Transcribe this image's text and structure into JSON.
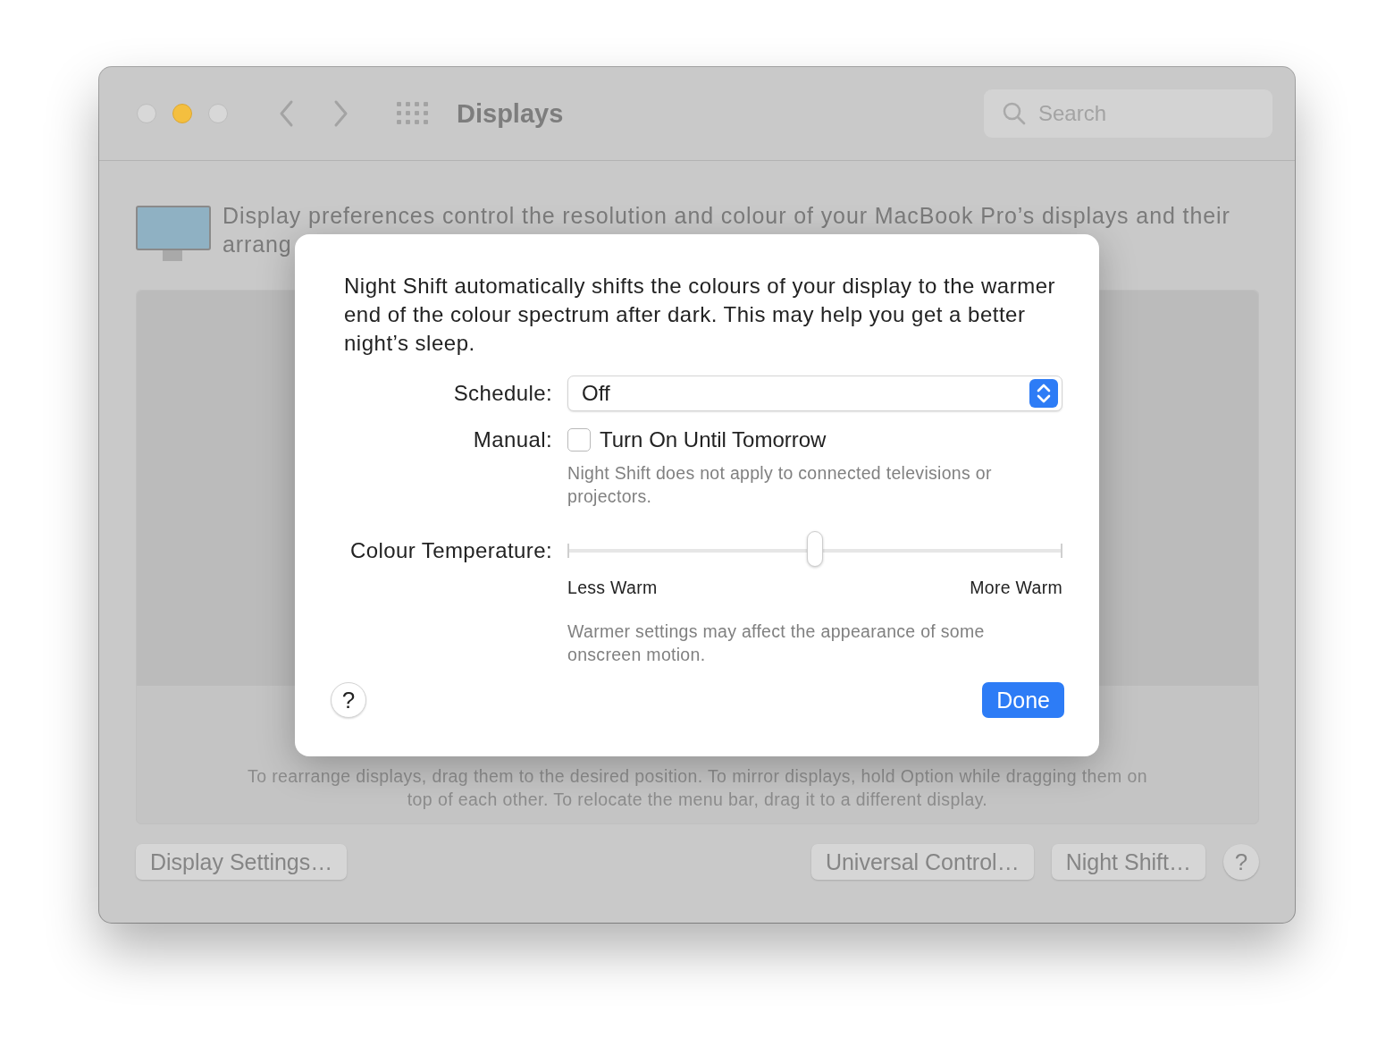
{
  "window": {
    "title": "Displays"
  },
  "search": {
    "placeholder": "Search"
  },
  "description": {
    "line_1": "Display preferences control the resolution and colour of your MacBook Pro’s displays and their",
    "line_2": "arrang"
  },
  "arrangement": {
    "caption": "To rearrange displays, drag them to the desired position. To mirror displays, hold Option while dragging them on top of each other. To relocate the menu bar, drag it to a different display."
  },
  "buttons": [
    {
      "label": "Display Settings…"
    },
    {
      "label": "Universal Control…"
    },
    {
      "label": "Night Shift…"
    }
  ],
  "help": "?",
  "sheet": {
    "description": "Night Shift automatically shifts the colours of your display to the warmer end of the colour spectrum after dark. This may help you get a better night’s sleep.",
    "schedule": {
      "label": "Schedule:",
      "value": "Off"
    },
    "manual": {
      "label": "Manual:",
      "option": "Turn On Until Tomorrow",
      "checked": false
    },
    "manual_note": "Night Shift does not apply to connected televisions or projectors.",
    "temperature": {
      "label": "Colour Temperature:",
      "level": 0.5,
      "min_label": "Less Warm",
      "max_label": "More Warm"
    },
    "temperature_note": "Warmer settings may affect the appearance of some onscreen motion.",
    "help": "?",
    "done": "Done"
  }
}
